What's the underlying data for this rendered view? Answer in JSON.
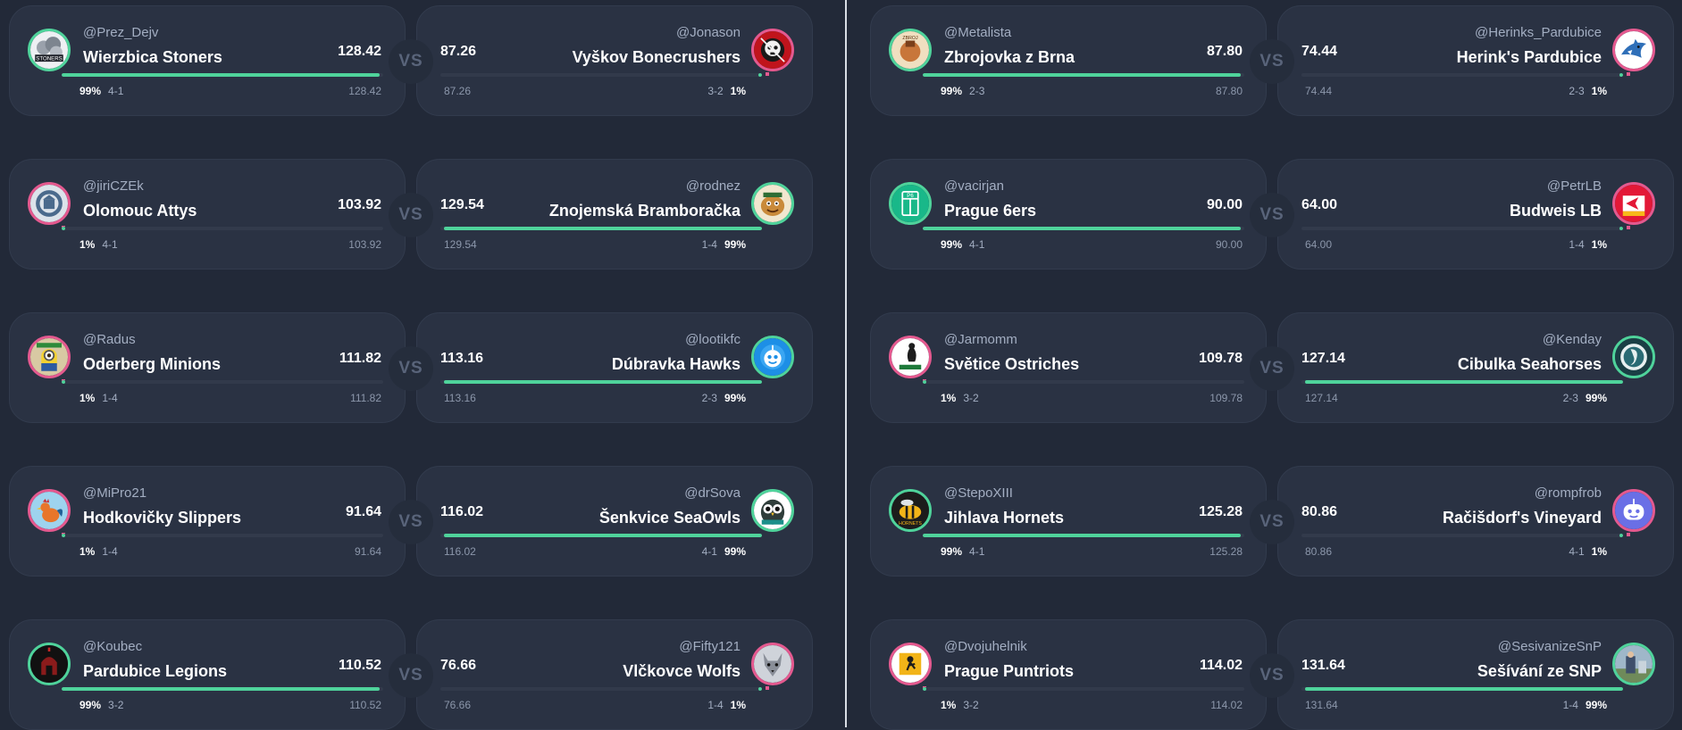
{
  "colors": {
    "win": "#4fd39b",
    "lose": "#e4598f",
    "background": "#222938",
    "card": "#2a3243"
  },
  "vs_label": "VS",
  "columns": [
    {
      "matchups": [
        {
          "home": {
            "owner": "@Prez_Dejv",
            "team": "Wierzbica Stoners",
            "score": "128.42",
            "projected": "128.42",
            "win_prob": "99%",
            "record": "4-1",
            "win": true,
            "icon": "stoners-smoke-logo-icon"
          },
          "away": {
            "owner": "@Jonason",
            "team": "Vyškov Bonecrushers",
            "score": "87.26",
            "projected": "87.26",
            "win_prob": "1%",
            "record": "3-2",
            "win": false,
            "icon": "bonecrushers-skull-logo-icon"
          }
        },
        {
          "home": {
            "owner": "@jiriCZEk",
            "team": "Olomouc Attys",
            "score": "103.92",
            "projected": "103.92",
            "win_prob": "1%",
            "record": "4-1",
            "win": false,
            "icon": "attys-seal-logo-icon"
          },
          "away": {
            "owner": "@rodnez",
            "team": "Znojemská Bramboračka",
            "score": "129.54",
            "projected": "129.54",
            "win_prob": "99%",
            "record": "1-4",
            "win": true,
            "icon": "bramboracka-potato-logo-icon"
          }
        },
        {
          "home": {
            "owner": "@Radus",
            "team": "Oderberg Minions",
            "score": "111.82",
            "projected": "111.82",
            "win_prob": "1%",
            "record": "1-4",
            "win": false,
            "icon": "minions-logo-icon"
          },
          "away": {
            "owner": "@lootikfc",
            "team": "Dúbravka Hawks",
            "score": "113.16",
            "projected": "113.16",
            "win_prob": "99%",
            "record": "2-3",
            "win": true,
            "icon": "hawks-robot-logo-icon"
          }
        },
        {
          "home": {
            "owner": "@MiPro21",
            "team": "Hodkovičky Slippers",
            "score": "91.64",
            "projected": "91.64",
            "win_prob": "1%",
            "record": "1-4",
            "win": false,
            "icon": "slippers-rooster-logo-icon"
          },
          "away": {
            "owner": "@drSova",
            "team": "Šenkvice SeaOwls",
            "score": "116.02",
            "projected": "116.02",
            "win_prob": "99%",
            "record": "4-1",
            "win": true,
            "icon": "seaowls-owl-logo-icon"
          }
        },
        {
          "home": {
            "owner": "@Koubec",
            "team": "Pardubice Legions",
            "score": "110.52",
            "projected": "110.52",
            "win_prob": "99%",
            "record": "3-2",
            "win": true,
            "icon": "legions-helmet-logo-icon"
          },
          "away": {
            "owner": "@Fifty121",
            "team": "Vlčkovce Wolfs",
            "score": "76.66",
            "projected": "76.66",
            "win_prob": "1%",
            "record": "1-4",
            "win": false,
            "icon": "wolfs-wolf-logo-icon"
          }
        }
      ]
    },
    {
      "matchups": [
        {
          "home": {
            "owner": "@Metalista",
            "team": "Zbrojovka z Brna",
            "score": "87.80",
            "projected": "87.80",
            "win_prob": "99%",
            "record": "2-3",
            "win": true,
            "icon": "zbrojovka-logo-icon"
          },
          "away": {
            "owner": "@Herinks_Pardubice",
            "team": "Herink's Pardubice",
            "score": "74.44",
            "projected": "74.44",
            "win_prob": "1%",
            "record": "2-3",
            "win": false,
            "icon": "herinks-shark-logo-icon"
          }
        },
        {
          "home": {
            "owner": "@vacirjan",
            "team": "Prague 6ers",
            "score": "90.00",
            "projected": "90.00",
            "win_prob": "99%",
            "record": "4-1",
            "win": true,
            "icon": "p6-logo-icon"
          },
          "away": {
            "owner": "@PetrLB",
            "team": "Budweis LB",
            "score": "64.00",
            "projected": "64.00",
            "win_prob": "1%",
            "record": "1-4",
            "win": false,
            "icon": "chiefs-arrowhead-logo-icon"
          }
        },
        {
          "home": {
            "owner": "@Jarmomm",
            "team": "Světice Ostriches",
            "score": "109.78",
            "projected": "109.78",
            "win_prob": "1%",
            "record": "3-2",
            "win": false,
            "icon": "ostriches-logo-icon"
          },
          "away": {
            "owner": "@Kenday",
            "team": "Cibulka Seahorses",
            "score": "127.14",
            "projected": "127.14",
            "win_prob": "99%",
            "record": "2-3",
            "win": true,
            "icon": "seahorses-logo-icon"
          }
        },
        {
          "home": {
            "owner": "@StepoXIII",
            "team": "Jihlava Hornets",
            "score": "125.28",
            "projected": "125.28",
            "win_prob": "99%",
            "record": "4-1",
            "win": true,
            "icon": "hornets-logo-icon"
          },
          "away": {
            "owner": "@rompfrob",
            "team": "Račišdorf's Vineyard",
            "score": "80.86",
            "projected": "80.86",
            "win_prob": "1%",
            "record": "4-1",
            "win": false,
            "icon": "vineyard-robot-logo-icon"
          }
        },
        {
          "home": {
            "owner": "@Dvojuhelnik",
            "team": "Prague Puntriots",
            "score": "114.02",
            "projected": "114.02",
            "win_prob": "1%",
            "record": "3-2",
            "win": false,
            "icon": "puntriots-logo-icon"
          },
          "away": {
            "owner": "@SesivanizeSnP",
            "team": "Sešívání ze SNP",
            "score": "131.64",
            "projected": "131.64",
            "win_prob": "99%",
            "record": "1-4",
            "win": true,
            "icon": "snp-photo-logo-icon"
          }
        }
      ]
    }
  ]
}
